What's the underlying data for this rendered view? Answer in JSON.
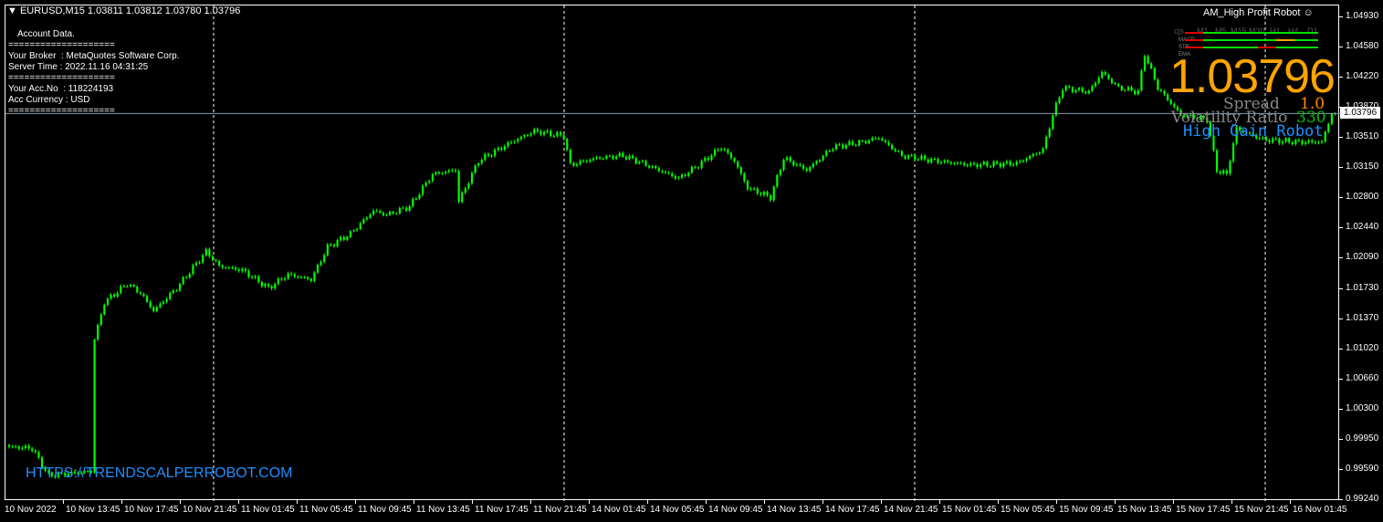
{
  "header": {
    "symbol_line": "EURUSD,M15  1.03811 1.03812 1.03780 1.03796"
  },
  "account": {
    "title": "Account Data.",
    "sep": "====================",
    "broker": "Your Broker  : MetaQuotes Software Corp.",
    "server_time": "Server Time : 2022.11.16 04:31:25",
    "acc_no": "Your Acc.No  : 118224193",
    "currency": "Acc Currency : USD"
  },
  "robot_panel": {
    "title": "AM_High Profit Robot",
    "timeframes": [
      "cjs",
      "M1",
      "M5",
      "M15",
      "M30",
      "H1",
      "H4",
      "D1"
    ],
    "rows": [
      "MACD",
      "STR",
      "EMA"
    ],
    "price": "1.03796",
    "spread_label": "Spread",
    "spread_value": "1.0",
    "vol_label": "Volatility Ratio",
    "vol_value": "330",
    "brand": "High Gain Robot",
    "colors": {
      "price": "#ffa500",
      "brand": "#1e90ff",
      "up": "#00e000",
      "down": "#e00000"
    }
  },
  "watermark": "HTTPS://TRENDSCALPERROBOT.COM",
  "current_price": "1.03796",
  "chart_data": {
    "type": "candlestick",
    "title": "EURUSD,M15",
    "y_ticks": [
      "1.04930",
      "1.04580",
      "1.04220",
      "1.03870",
      "1.03510",
      "1.03150",
      "1.02800",
      "1.02440",
      "1.02090",
      "1.01730",
      "1.01370",
      "1.01020",
      "1.00660",
      "1.00300",
      "0.99950",
      "0.99590",
      "0.99240"
    ],
    "ylim": [
      0.9921,
      1.0529
    ],
    "x_ticks": [
      "10 Nov 2022",
      "10 Nov 13:45",
      "10 Nov 17:45",
      "10 Nov 21:45",
      "11 Nov 01:45",
      "11 Nov 05:45",
      "11 Nov 09:45",
      "11 Nov 13:45",
      "11 Nov 17:45",
      "11 Nov 21:45",
      "14 Nov 01:45",
      "14 Nov 05:45",
      "14 Nov 09:45",
      "14 Nov 13:45",
      "14 Nov 17:45",
      "14 Nov 21:45",
      "15 Nov 01:45",
      "15 Nov 05:45",
      "15 Nov 09:45",
      "15 Nov 13:45",
      "15 Nov 17:45",
      "15 Nov 21:45",
      "16 Nov 01:45"
    ],
    "bar_count": 405,
    "close_keyframes": [
      [
        0,
        0.9987
      ],
      [
        7,
        0.9985
      ],
      [
        12,
        0.9953
      ],
      [
        25,
        0.9958
      ],
      [
        26,
        1.0114
      ],
      [
        29,
        1.0157
      ],
      [
        36,
        1.0179
      ],
      [
        40,
        1.0168
      ],
      [
        44,
        1.0147
      ],
      [
        51,
        1.0174
      ],
      [
        60,
        1.0217
      ],
      [
        64,
        1.02
      ],
      [
        71,
        1.0195
      ],
      [
        79,
        1.0174
      ],
      [
        85,
        1.019
      ],
      [
        92,
        1.0184
      ],
      [
        97,
        1.0222
      ],
      [
        104,
        1.0238
      ],
      [
        111,
        1.0265
      ],
      [
        115,
        1.026
      ],
      [
        122,
        1.027
      ],
      [
        129,
        1.0308
      ],
      [
        136,
        1.0313
      ],
      [
        137,
        1.0276
      ],
      [
        143,
        1.0324
      ],
      [
        153,
        1.0346
      ],
      [
        160,
        1.0359
      ],
      [
        169,
        1.0353
      ],
      [
        171,
        1.0319
      ],
      [
        179,
        1.0327
      ],
      [
        187,
        1.033
      ],
      [
        193,
        1.0321
      ],
      [
        204,
        1.0303
      ],
      [
        210,
        1.0319
      ],
      [
        217,
        1.034
      ],
      [
        221,
        1.0324
      ],
      [
        225,
        1.0292
      ],
      [
        232,
        1.0281
      ],
      [
        236,
        1.0327
      ],
      [
        243,
        1.0313
      ],
      [
        251,
        1.034
      ],
      [
        260,
        1.0346
      ],
      [
        265,
        1.0351
      ],
      [
        272,
        1.033
      ],
      [
        282,
        1.0324
      ],
      [
        293,
        1.0319
      ],
      [
        307,
        1.0321
      ],
      [
        315,
        1.0337
      ],
      [
        318,
        1.0378
      ],
      [
        321,
        1.041
      ],
      [
        329,
        1.0405
      ],
      [
        333,
        1.0428
      ],
      [
        338,
        1.041
      ],
      [
        344,
        1.0405
      ],
      [
        346,
        1.045
      ],
      [
        350,
        1.041
      ],
      [
        357,
        1.0378
      ],
      [
        365,
        1.0373
      ],
      [
        368,
        1.0313
      ],
      [
        371,
        1.0308
      ],
      [
        374,
        1.0362
      ],
      [
        382,
        1.0349
      ],
      [
        393,
        1.0346
      ],
      [
        400,
        1.0346
      ],
      [
        403,
        1.038
      ],
      [
        404,
        1.03796
      ]
    ]
  }
}
